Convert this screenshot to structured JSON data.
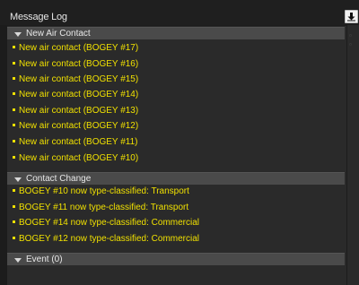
{
  "window": {
    "title": "Message Log"
  },
  "icons": {
    "download": "download-icon"
  },
  "sections": [
    {
      "label": "New Air Contact",
      "messages": [
        "New air contact (BOGEY #17)",
        "New air contact (BOGEY #16)",
        "New air contact (BOGEY #15)",
        "New air contact (BOGEY #14)",
        "New air contact (BOGEY #13)",
        "New air contact (BOGEY #12)",
        "New air contact (BOGEY #11)",
        "New air contact (BOGEY #10)"
      ]
    },
    {
      "label": "Contact Change",
      "messages": [
        "BOGEY #10 now type-classified: Transport",
        "BOGEY #11 now type-classified: Transport",
        "BOGEY #14 now type-classified: Commercial",
        "BOGEY #12 now type-classified: Commercial"
      ]
    },
    {
      "label": "Event (0)",
      "messages": []
    }
  ],
  "colors": {
    "message_text": "#f0e000",
    "header_bg": "#4a4a4a",
    "panel_bg": "#2a2a2a"
  }
}
